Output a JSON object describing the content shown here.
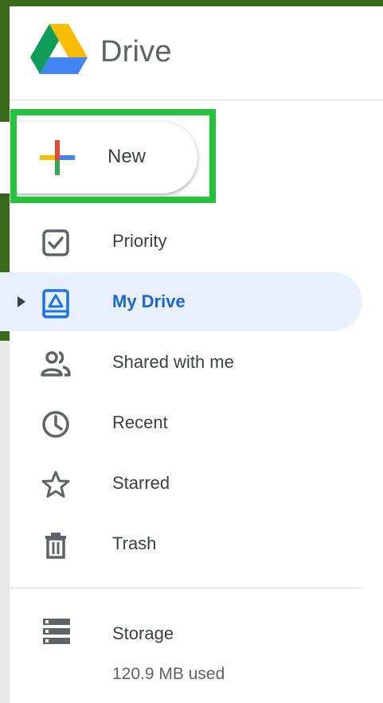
{
  "app": {
    "brand_name": "Drive"
  },
  "new_button": {
    "label": "New"
  },
  "nav": {
    "items": [
      {
        "label": "Priority",
        "icon": "priority-checkbox-icon"
      },
      {
        "label": "My Drive",
        "icon": "my-drive-icon",
        "active": true
      },
      {
        "label": "Shared with me",
        "icon": "shared-people-icon"
      },
      {
        "label": "Recent",
        "icon": "clock-icon"
      },
      {
        "label": "Starred",
        "icon": "star-icon"
      },
      {
        "label": "Trash",
        "icon": "trash-icon"
      }
    ]
  },
  "storage": {
    "label": "Storage",
    "used_text": "120.9 MB used"
  },
  "colors": {
    "active_bg": "#e8f0fe",
    "active_text": "#1967d2",
    "highlight": "#22c43a",
    "icon_grey": "#5f6368"
  }
}
